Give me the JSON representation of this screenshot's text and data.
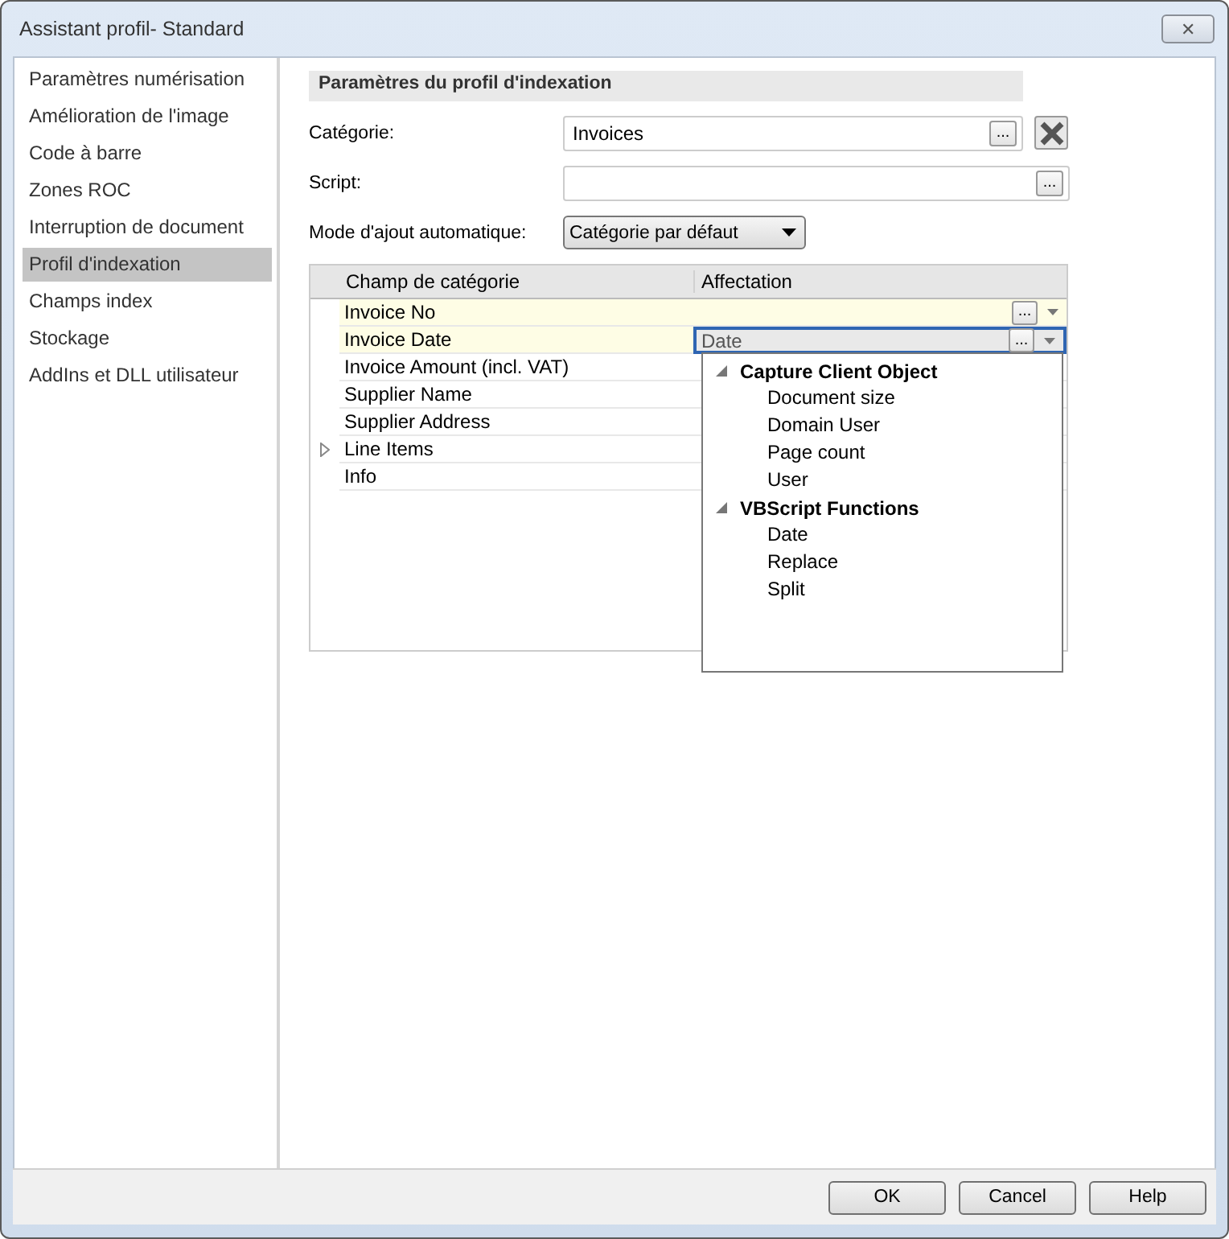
{
  "window": {
    "title": "Assistant profil- Standard",
    "close_button": "✕"
  },
  "sidebar": {
    "items": [
      {
        "label": "Paramètres numérisation",
        "selected": false
      },
      {
        "label": "Amélioration de l'image",
        "selected": false
      },
      {
        "label": "Code à barre",
        "selected": false
      },
      {
        "label": "Zones ROC",
        "selected": false
      },
      {
        "label": "Interruption de document",
        "selected": false
      },
      {
        "label": "Profil d'indexation",
        "selected": true
      },
      {
        "label": "Champs index",
        "selected": false
      },
      {
        "label": "Stockage",
        "selected": false
      },
      {
        "label": "AddIns et DLL utilisateur",
        "selected": false
      }
    ]
  },
  "section_title": "Paramètres du profil d'indexation",
  "category": {
    "label": "Catégorie:",
    "value": "Invoices",
    "browse_button": "..."
  },
  "script": {
    "label": "Script:",
    "browse_button": "..."
  },
  "auto_mode": {
    "label": "Mode d'ajout automatique:",
    "value": "Catégorie par défaut"
  },
  "table": {
    "columns": [
      "Champ de catégorie",
      "Affectation"
    ],
    "rows": [
      {
        "name": "Invoice No",
        "selected": true,
        "editing": false,
        "browse_button": "..."
      },
      {
        "name": "Invoice Date",
        "selected": true,
        "editing": true,
        "value": "Date",
        "browse_button": "..."
      },
      {
        "name": "Invoice Amount (incl. VAT)",
        "selected": false,
        "editing": false
      },
      {
        "name": "Supplier Name",
        "selected": false,
        "editing": false
      },
      {
        "name": "Supplier Address",
        "selected": false,
        "editing": false
      },
      {
        "name": "Line Items",
        "selected": false,
        "editing": false,
        "expanded": false
      },
      {
        "name": "Info",
        "selected": false,
        "editing": false
      }
    ]
  },
  "dropdown": {
    "groups": [
      {
        "label": "Capture Client Object",
        "expanded": true,
        "children": [
          {
            "label": "Document size"
          },
          {
            "label": "Domain User"
          },
          {
            "label": "Page count"
          },
          {
            "label": "User"
          }
        ]
      },
      {
        "label": "VBScript Functions",
        "expanded": true,
        "children": [
          {
            "label": "Date"
          },
          {
            "label": "Replace"
          },
          {
            "label": "Split"
          }
        ]
      }
    ]
  },
  "buttons": [
    "OK",
    "Cancel",
    "Help"
  ]
}
